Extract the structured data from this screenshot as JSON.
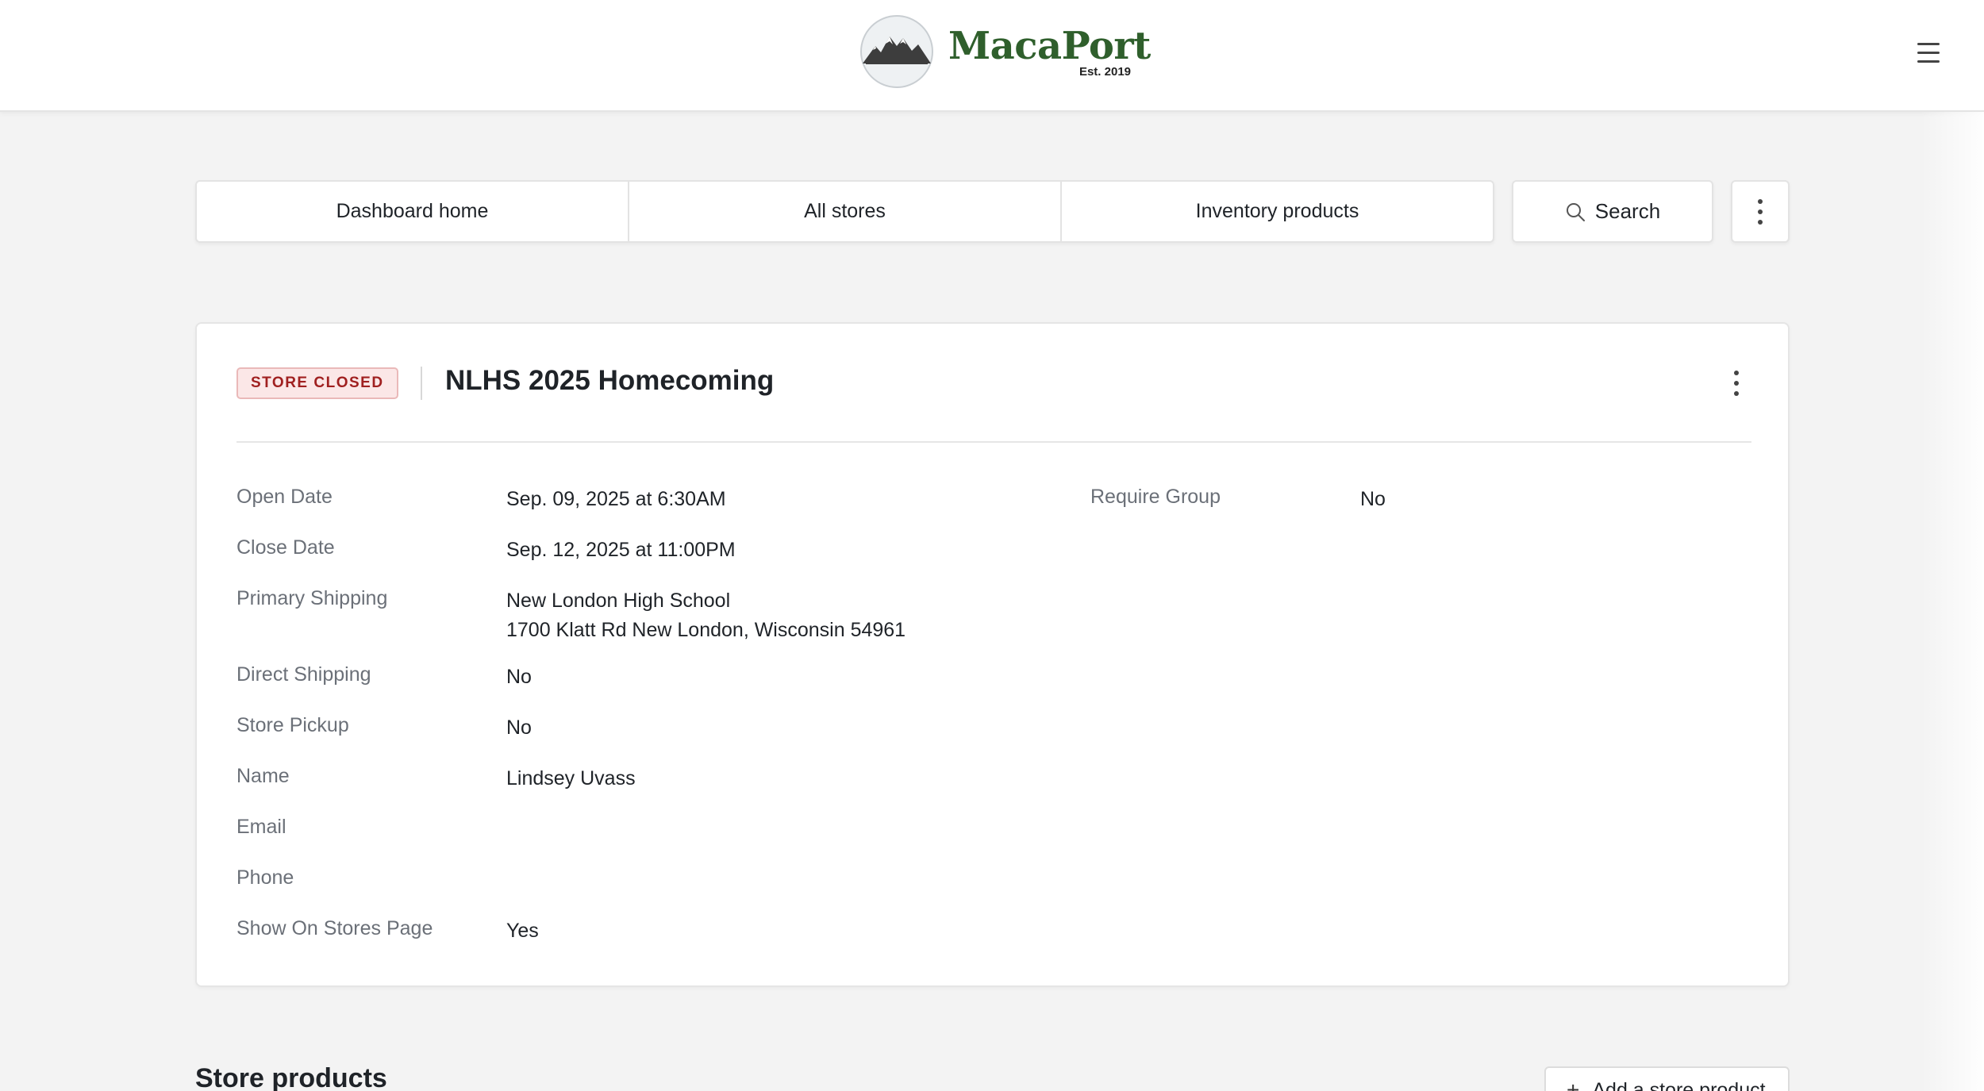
{
  "header": {
    "brand_name": "MacaPort",
    "brand_tagline": "Est. 2019",
    "logo_icon": "mountain-logo-icon",
    "menu_icon": "hamburger-menu-icon"
  },
  "nav": {
    "tabs": [
      {
        "label": "Dashboard home"
      },
      {
        "label": "All stores"
      },
      {
        "label": "Inventory products"
      }
    ],
    "search_label": "Search",
    "search_icon": "search-icon",
    "more_icon": "more-vertical-icon"
  },
  "store": {
    "status": "STORE CLOSED",
    "status_color": "#a02020",
    "title": "NLHS 2025 Homecoming",
    "fields": {
      "open_date": {
        "label": "Open Date",
        "value": "Sep. 09, 2025 at 6:30AM"
      },
      "close_date": {
        "label": "Close Date",
        "value": "Sep. 12, 2025 at 11:00PM"
      },
      "primary_shipping": {
        "label": "Primary Shipping",
        "line1": "New London High School",
        "line2": "1700 Klatt Rd New London, Wisconsin 54961"
      },
      "direct_shipping": {
        "label": "Direct Shipping",
        "value": "No"
      },
      "store_pickup": {
        "label": "Store Pickup",
        "value": "No"
      },
      "name": {
        "label": "Name",
        "value": "Lindsey Uvass"
      },
      "email": {
        "label": "Email",
        "value": ""
      },
      "phone": {
        "label": "Phone",
        "value": ""
      },
      "show_on_stores_page": {
        "label": "Show On Stores Page",
        "value": "Yes"
      },
      "require_group": {
        "label": "Require Group",
        "value": "No"
      }
    }
  },
  "products": {
    "section_title": "Store products",
    "add_button_label": "Add a store product",
    "add_icon": "plus-icon"
  },
  "colors": {
    "brand_green": "#2f5f2c",
    "page_background": "#f3f3f3"
  }
}
